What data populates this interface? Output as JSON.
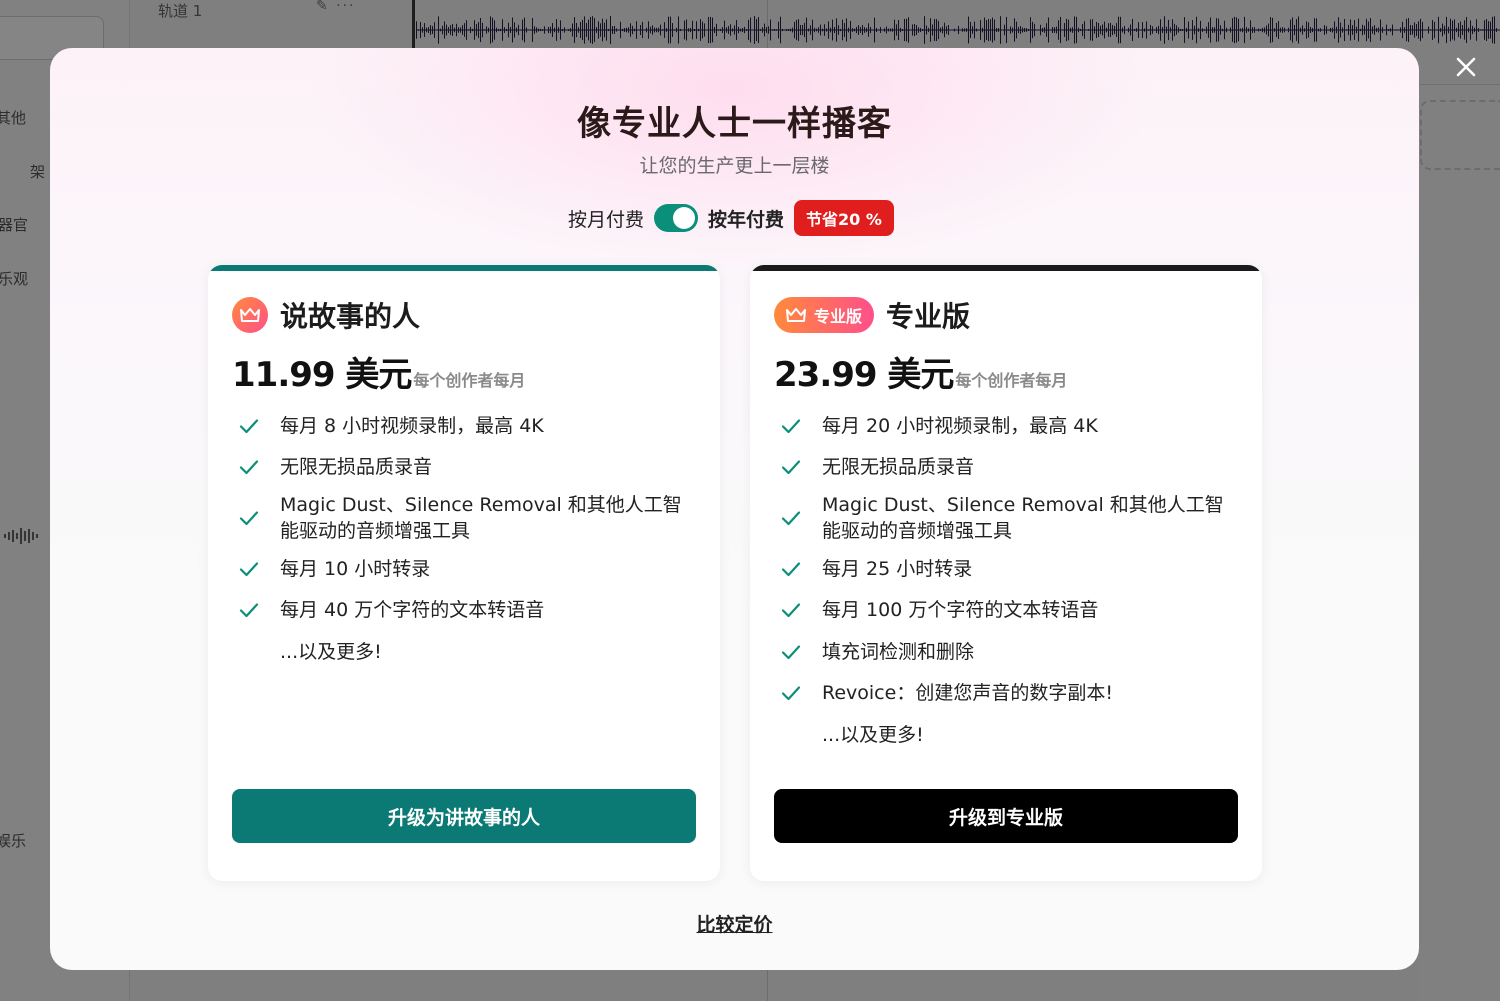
{
  "background": {
    "sidebar_items": [
      "其他",
      "架",
      "器官",
      "乐观",
      "娱乐"
    ],
    "track_label": "轨道 1",
    "track_icons": "✎ ···"
  },
  "modal": {
    "close_icon": "close-icon",
    "title": "像专业人士一样播客",
    "subtitle": "让您的生产更上一层楼",
    "billing": {
      "monthly_label": "按月付费",
      "yearly_label": "按年付费",
      "toggle_state": "yearly",
      "save_badge": "节省20 %"
    },
    "plans": [
      {
        "name": "说故事的人",
        "price": "11.99 美元",
        "per": "每个创作者每月",
        "features": [
          "每月 8 小时视频录制，最高 4K",
          "无限无损品质录音",
          "Magic Dust、Silence Removal 和其他人工智能驱动的音频增强工具",
          "每月 10 小时转录",
          "每月 40 万个字符的文本转语音"
        ],
        "more": "...以及更多!",
        "cta": "升级为讲故事的人",
        "accent": "#0b7a74"
      },
      {
        "badge": "专业版",
        "name": "专业版",
        "price": "23.99 美元",
        "per": "每个创作者每月",
        "features": [
          "每月 20 小时视频录制，最高 4K",
          "无限无损品质录音",
          "Magic Dust、Silence Removal 和其他人工智能驱动的音频增强工具",
          "每月 25 小时转录",
          "每月 100 万个字符的文本转语音",
          "填充词检测和删除",
          "Revoice：创建您声音的数字副本!"
        ],
        "more": "...以及更多!",
        "cta": "升级到专业版",
        "accent": "#000000"
      }
    ],
    "compare_link": "比较定价"
  }
}
